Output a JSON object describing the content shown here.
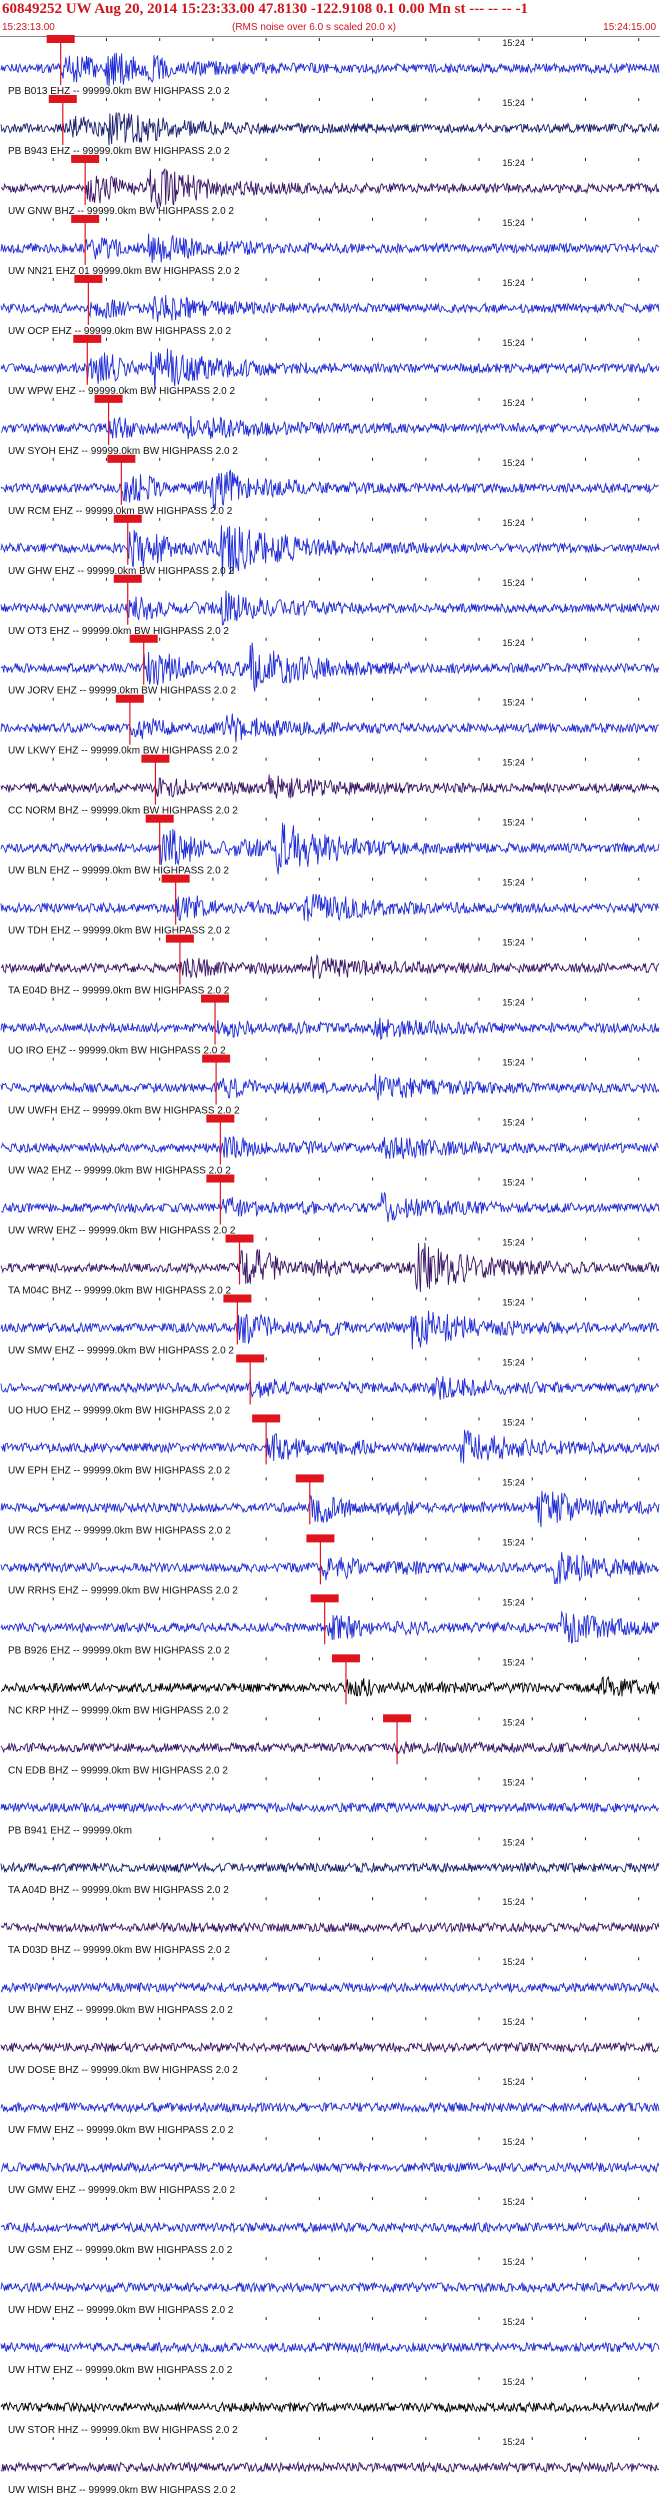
{
  "header": {
    "title": "60849252 UW Aug 20, 2014 15:23:33.00   47.8130 -122.9108  0.1 0.00 Mn st --- -- --  -1",
    "start_time": "15:23:13.00",
    "noise_note": "(RMS noise over 6.0 s scaled 20.0 x)",
    "end_time": "15:24:15.00"
  },
  "colors": {
    "trace_blue": "#1f2bd6",
    "trace_navy": "#1a1f6b",
    "trace_purple": "#3a1466",
    "trace_black": "#000000",
    "pick_red": "#e0141c",
    "title_red": "#d0141c"
  },
  "chart_data": {
    "type": "seismogram",
    "time_range_s": [
      0,
      62
    ],
    "minute_tick_label": "15:24",
    "minute_tick_time_s": 47,
    "tick_interval_s": 5,
    "traces": [
      {
        "label": "PB B013 EHZ -- 99999.0km BW  HIGHPASS  2.0  2",
        "color": "blue",
        "pick_s": 5.7,
        "amp": 0.5
      },
      {
        "label": "PB B943 EHZ -- 99999.0km BW  HIGHPASS  2.0  2",
        "color": "navy",
        "pick_s": 5.9,
        "amp": 0.45
      },
      {
        "label": "UW GNW BHZ -- 99999.0km BW  HIGHPASS  2.0  2",
        "color": "purple",
        "pick_s": 8.0,
        "amp": 0.55
      },
      {
        "label": "UW NN21 EHZ 01 99999.0km BW  HIGHPASS  2.0  2",
        "color": "blue",
        "pick_s": 8.0,
        "amp": 0.35
      },
      {
        "label": "UW OCP EHZ -- 99999.0km BW  HIGHPASS  2.0  2",
        "color": "blue",
        "pick_s": 8.3,
        "amp": 0.3
      },
      {
        "label": "UW WPW EHZ -- 99999.0km BW  HIGHPASS  2.0  2",
        "color": "blue",
        "pick_s": 8.2,
        "amp": 0.6
      },
      {
        "label": "UW SYOH EHZ -- 99999.0km BW  HIGHPASS  2.0  2",
        "color": "blue",
        "pick_s": 10.2,
        "amp": 0.35
      },
      {
        "label": "UW RCM EHZ -- 99999.0km BW  HIGHPASS  2.0  2",
        "color": "blue",
        "pick_s": 11.4,
        "amp": 0.55
      },
      {
        "label": "UW GHW EHZ -- 99999.0km BW  HIGHPASS  2.0  2",
        "color": "blue",
        "pick_s": 12.0,
        "amp": 0.85
      },
      {
        "label": "UW OT3 EHZ -- 99999.0km BW  HIGHPASS  2.0  2",
        "color": "blue",
        "pick_s": 12.0,
        "amp": 0.4
      },
      {
        "label": "UW JORV EHZ -- 99999.0km BW  HIGHPASS  2.0  2",
        "color": "blue",
        "pick_s": 13.5,
        "amp": 0.7
      },
      {
        "label": "UW LKWY EHZ -- 99999.0km BW  HIGHPASS  2.0  2",
        "color": "blue",
        "pick_s": 12.2,
        "amp": 0.35
      },
      {
        "label": "CC NORM BHZ -- 99999.0km BW  HIGHPASS  2.0  2",
        "color": "purple",
        "pick_s": 14.6,
        "amp": 0.3
      },
      {
        "label": "UW BLN EHZ -- 99999.0km BW  HIGHPASS  2.0  2",
        "color": "blue",
        "pick_s": 15.0,
        "amp": 0.8
      },
      {
        "label": "UW TDH EHZ -- 99999.0km BW  HIGHPASS  2.0  2",
        "color": "blue",
        "pick_s": 16.5,
        "amp": 0.45
      },
      {
        "label": "TA E04D BHZ -- 99999.0km BW  HIGHPASS  2.0  2",
        "color": "purple",
        "pick_s": 16.9,
        "amp": 0.3
      },
      {
        "label": "UO IRO EHZ -- 99999.0km BW  HIGHPASS  2.0  2",
        "color": "blue",
        "pick_s": 20.2,
        "amp": 0.25
      },
      {
        "label": "UW UWFH EHZ -- 99999.0km BW  HIGHPASS  2.0  2",
        "color": "blue",
        "pick_s": 20.3,
        "amp": 0.35
      },
      {
        "label": "UW WA2 EHZ -- 99999.0km BW  HIGHPASS  2.0  2",
        "color": "blue",
        "pick_s": 20.7,
        "amp": 0.35
      },
      {
        "label": "UW WRW EHZ -- 99999.0km BW  HIGHPASS  2.0  2",
        "color": "blue",
        "pick_s": 20.7,
        "amp": 0.35
      },
      {
        "label": "TA M04C BHZ -- 99999.0km BW  HIGHPASS  2.0  2",
        "color": "purple",
        "pick_s": 22.5,
        "amp": 0.8
      },
      {
        "label": "UW SMW EHZ -- 99999.0km BW  HIGHPASS  2.0  2",
        "color": "blue",
        "pick_s": 22.3,
        "amp": 0.6
      },
      {
        "label": "UO HUO EHZ -- 99999.0km BW  HIGHPASS  2.0  2",
        "color": "blue",
        "pick_s": 23.5,
        "amp": 0.3
      },
      {
        "label": "UW EPH EHZ -- 99999.0km BW  HIGHPASS  2.0  2",
        "color": "blue",
        "pick_s": 25.0,
        "amp": 0.5
      },
      {
        "label": "UW RCS EHZ -- 99999.0km BW  HIGHPASS  2.0  2",
        "color": "blue",
        "pick_s": 29.1,
        "amp": 0.55
      },
      {
        "label": "UW RRHS EHZ -- 99999.0km BW  HIGHPASS  2.0  2",
        "color": "blue",
        "pick_s": 30.1,
        "amp": 0.45
      },
      {
        "label": "PB B926 EHZ -- 99999.0km BW  HIGHPASS  2.0  2",
        "color": "blue",
        "pick_s": 30.5,
        "amp": 0.45
      },
      {
        "label": "NC KRP HHZ -- 99999.0km BW  HIGHPASS  2.0  2",
        "color": "black",
        "pick_s": 32.5,
        "amp": 0.25
      },
      {
        "label": "CN EDB BHZ -- 99999.0km BW  HIGHPASS  2.0  2",
        "color": "purple",
        "pick_s": 37.3,
        "amp": 0.15
      },
      {
        "label": "PB B941 EHZ -- 99999.0km",
        "color": "blue",
        "pick_s": null,
        "amp": 0
      },
      {
        "label": "TA A04D BHZ -- 99999.0km BW  HIGHPASS  2.0  2",
        "color": "navy",
        "pick_s": null,
        "amp": 0
      },
      {
        "label": "TA D03D BHZ -- 99999.0km BW  HIGHPASS  2.0  2",
        "color": "purple",
        "pick_s": null,
        "amp": 0
      },
      {
        "label": "UW BHW EHZ -- 99999.0km BW  HIGHPASS  2.0  2",
        "color": "blue",
        "pick_s": null,
        "amp": 0
      },
      {
        "label": "UW DOSE BHZ -- 99999.0km BW  HIGHPASS  2.0  2",
        "color": "purple",
        "pick_s": null,
        "amp": 0
      },
      {
        "label": "UW FMW EHZ -- 99999.0km BW  HIGHPASS  2.0  2",
        "color": "blue",
        "pick_s": null,
        "amp": 0
      },
      {
        "label": "UW GMW EHZ -- 99999.0km BW  HIGHPASS  2.0  2",
        "color": "blue",
        "pick_s": null,
        "amp": 0
      },
      {
        "label": "UW GSM EHZ -- 99999.0km BW  HIGHPASS  2.0  2",
        "color": "blue",
        "pick_s": null,
        "amp": 0
      },
      {
        "label": "UW HDW EHZ -- 99999.0km BW  HIGHPASS  2.0  2",
        "color": "blue",
        "pick_s": null,
        "amp": 0
      },
      {
        "label": "UW HTW EHZ -- 99999.0km BW  HIGHPASS  2.0  2",
        "color": "blue",
        "pick_s": null,
        "amp": 0
      },
      {
        "label": "UW STOR HHZ -- 99999.0km BW  HIGHPASS  2.0  2",
        "color": "black",
        "pick_s": null,
        "amp": 0
      },
      {
        "label": "UW WISH BHZ -- 99999.0km BW  HIGHPASS  2.0  2",
        "color": "purple",
        "pick_s": null,
        "amp": 0
      }
    ]
  }
}
